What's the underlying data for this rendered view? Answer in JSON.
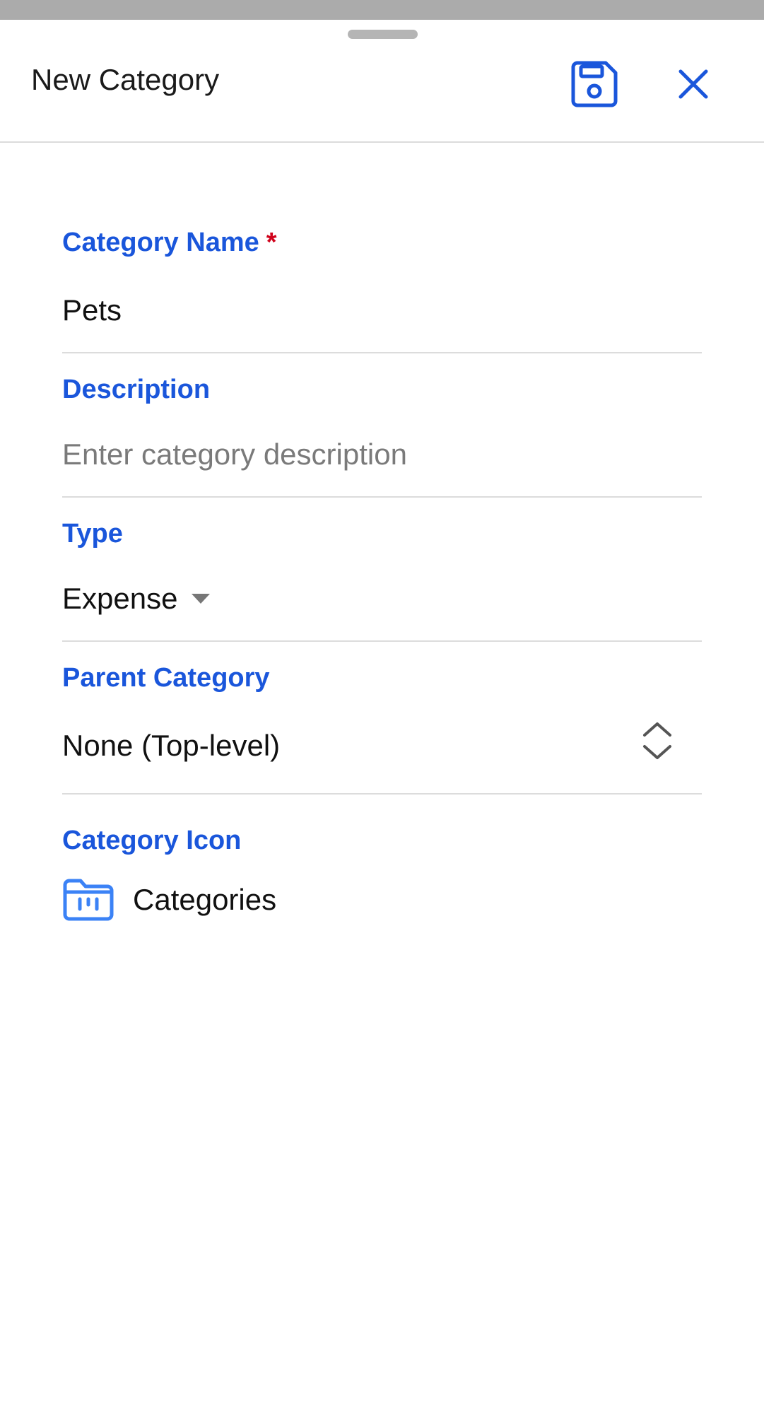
{
  "header": {
    "title": "New Category",
    "save_icon": "save-icon",
    "close_icon": "close-icon"
  },
  "form": {
    "name": {
      "label": "Category Name",
      "required_mark": "*",
      "value": "Pets"
    },
    "description": {
      "label": "Description",
      "placeholder": "Enter category description",
      "value": ""
    },
    "type": {
      "label": "Type",
      "selected": "Expense"
    },
    "parent": {
      "label": "Parent Category",
      "selected": "None (Top-level)"
    },
    "icon": {
      "label": "Category Icon",
      "icon_name": "categories-folder-icon",
      "value": "Categories"
    }
  },
  "colors": {
    "accent": "#1a56db",
    "required": "#d0021b",
    "divider": "#dcdcdc"
  }
}
